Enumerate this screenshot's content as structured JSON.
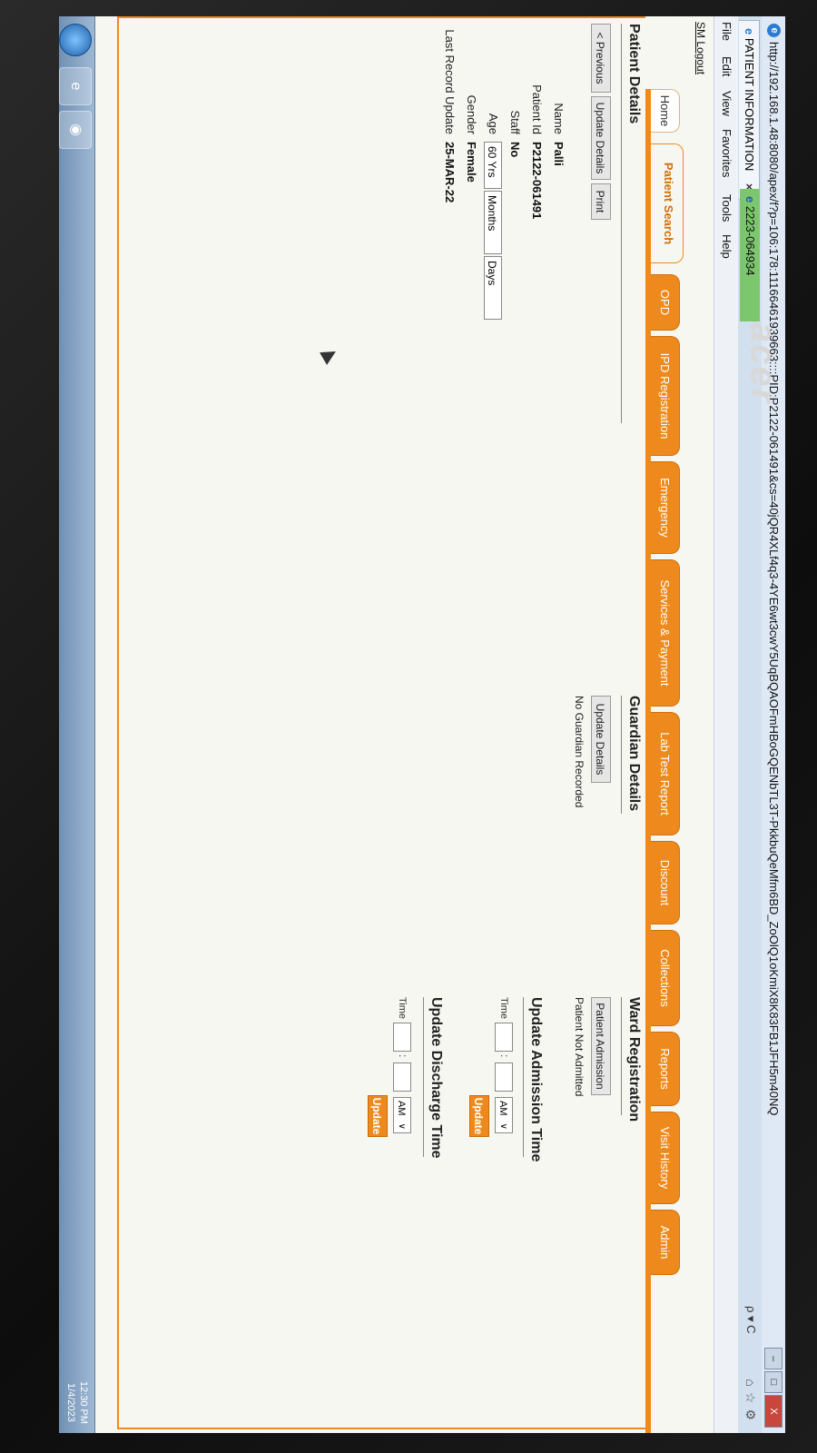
{
  "browser": {
    "url": "http://192.168.1.48:8080/apex/f?p=106:178:11166461939663::::PID:P2122-061491&cs=40jQR4XLf4q3-4YE6wt3cwY5UqBQAOFmHBoGQENbTL3T-PkkbuQeMfm6BD_ZoOlQ1oKmiX8K83FB1JFH5m40NQ",
    "tabs": [
      {
        "label": "PATIENT INFORMATION",
        "close": "×"
      },
      {
        "label": "2223-064934"
      }
    ],
    "search_label": "ρ ▾ C",
    "menu": [
      "File",
      "Edit",
      "View",
      "Favorites",
      "Tools",
      "Help"
    ],
    "window_buttons": [
      "–",
      "□",
      "X"
    ],
    "toolbar_icons": [
      "home-icon",
      "star-icon",
      "gear-icon"
    ]
  },
  "app": {
    "logout_label": "SM Logout",
    "nav_tabs": [
      "Home",
      "Patient Search",
      "OPD",
      "IPD Registration",
      "Emergency",
      "Services & Payment",
      "Lab Test Report",
      "Discount",
      "Collections",
      "Reports",
      "Visit History",
      "Admin"
    ],
    "selected_tab": "Patient Search"
  },
  "patient_details": {
    "title": "Patient Details",
    "buttons": {
      "previous": "< Previous",
      "update": "Update Details",
      "print": "Print"
    },
    "fields": {
      "name_label": "Name",
      "name_value": "Palli",
      "id_label": "Patient Id",
      "id_value": "P2122-061491",
      "staff_label": "Staff",
      "staff_value": "No",
      "age_label": "Age",
      "age_years": "60 Yrs",
      "age_months": "Months",
      "age_days": "Days",
      "gender_label": "Gender",
      "gender_value": "Female",
      "last_update_label": "Last Record Update",
      "last_update_value": "25-MAR-22"
    }
  },
  "guardian_details": {
    "title": "Guardian Details",
    "button": "Update Details",
    "status": "No Guardian Recorded"
  },
  "ward_registration": {
    "title": "Ward Registration",
    "button": "Patient Admission",
    "status": "Patient Not Admitted"
  },
  "admission_time": {
    "title": "Update Admission Time",
    "time_label": "Time",
    "colon": ":",
    "ampm": "AM",
    "button": "Update"
  },
  "discharge_time": {
    "title": "Update Discharge Time",
    "time_label": "Time",
    "colon": ":",
    "ampm": "AM",
    "button": "Update"
  },
  "taskbar": {
    "time": "12:30 PM",
    "date": "1/4/2023",
    "apps": [
      "ie-icon",
      "firefox-icon"
    ]
  },
  "monitor": {
    "brand": "acer"
  },
  "colors": {
    "accent": "#ee8a1d",
    "page_bg": "#f7f7f2"
  }
}
